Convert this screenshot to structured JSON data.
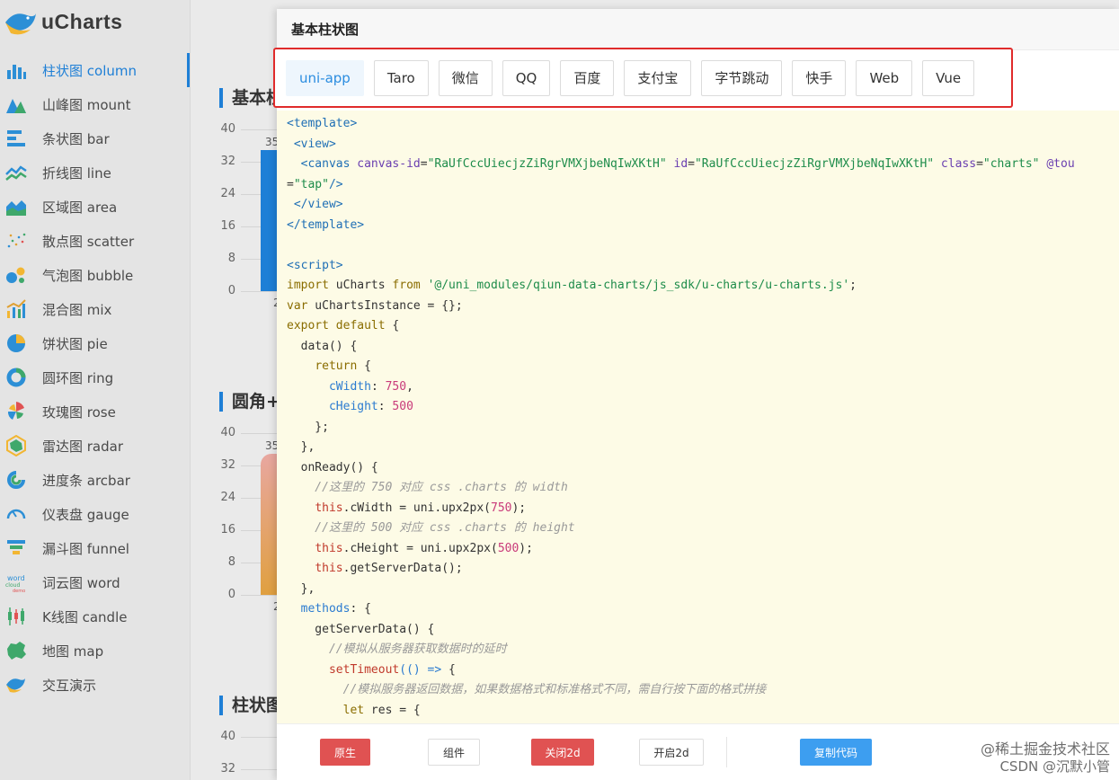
{
  "app": {
    "logo_text": "uCharts"
  },
  "sidebar": {
    "items": [
      {
        "label": "柱状图  column",
        "icon": "column-chart-icon",
        "active": true
      },
      {
        "label": "山峰图  mount",
        "icon": "mountain-chart-icon"
      },
      {
        "label": "条状图  bar",
        "icon": "bar-chart-icon"
      },
      {
        "label": "折线图  line",
        "icon": "line-chart-icon"
      },
      {
        "label": "区域图  area",
        "icon": "area-chart-icon"
      },
      {
        "label": "散点图  scatter",
        "icon": "scatter-chart-icon"
      },
      {
        "label": "气泡图  bubble",
        "icon": "bubble-chart-icon"
      },
      {
        "label": "混合图  mix",
        "icon": "mix-chart-icon"
      },
      {
        "label": "饼状图  pie",
        "icon": "pie-chart-icon"
      },
      {
        "label": "圆环图  ring",
        "icon": "ring-chart-icon"
      },
      {
        "label": "玫瑰图  rose",
        "icon": "rose-chart-icon"
      },
      {
        "label": "雷达图  radar",
        "icon": "radar-chart-icon"
      },
      {
        "label": "进度条  arcbar",
        "icon": "arcbar-chart-icon"
      },
      {
        "label": "仪表盘  gauge",
        "icon": "gauge-chart-icon"
      },
      {
        "label": "漏斗图  funnel",
        "icon": "funnel-chart-icon"
      },
      {
        "label": "词云图  word",
        "icon": "wordcloud-chart-icon"
      },
      {
        "label": "K线图  candle",
        "icon": "candle-chart-icon"
      },
      {
        "label": "地图  map",
        "icon": "map-chart-icon"
      },
      {
        "label": "交互演示",
        "icon": "logo-bird-icon"
      }
    ]
  },
  "background": {
    "sections": [
      {
        "title": "基本柱",
        "yticks": [
          "40",
          "32",
          "24",
          "16",
          "8",
          "0"
        ],
        "bar_value_label": "35",
        "bar_value": 35,
        "ymax": 40,
        "x_label": "2"
      },
      {
        "title": "圆角+",
        "yticks": [
          "40",
          "32",
          "24",
          "16",
          "8",
          "0"
        ],
        "bar_value_label": "35",
        "bar_value": 35,
        "ymax": 40,
        "x_label": "2"
      },
      {
        "title": "柱状图",
        "yticks": [
          "40",
          "32"
        ]
      }
    ]
  },
  "modal": {
    "title": "基本柱状图",
    "tabs": [
      {
        "label": "uni-app",
        "active": true
      },
      {
        "label": "Taro"
      },
      {
        "label": "微信"
      },
      {
        "label": "QQ"
      },
      {
        "label": "百度"
      },
      {
        "label": "支付宝"
      },
      {
        "label": "字节跳动"
      },
      {
        "label": "快手"
      },
      {
        "label": "Web"
      },
      {
        "label": "Vue"
      }
    ],
    "code_lines": [
      [
        [
          "t",
          "<template>"
        ]
      ],
      [
        [
          "p",
          " "
        ],
        [
          "t",
          "<view>"
        ]
      ],
      [
        [
          "p",
          "  "
        ],
        [
          "t",
          "<canvas "
        ],
        [
          "a",
          "canvas-id"
        ],
        [
          "p",
          "="
        ],
        [
          "s",
          "\"RaUfCccUiecjzZiRgrVMXjbeNqIwXKtH\""
        ],
        [
          "p",
          " "
        ],
        [
          "a",
          "id"
        ],
        [
          "p",
          "="
        ],
        [
          "s",
          "\"RaUfCccUiecjzZiRgrVMXjbeNqIwXKtH\""
        ],
        [
          "p",
          " "
        ],
        [
          "a",
          "class"
        ],
        [
          "p",
          "="
        ],
        [
          "s",
          "\"charts\""
        ],
        [
          "p",
          " "
        ],
        [
          "a",
          "@tou"
        ]
      ],
      [
        [
          "p",
          "="
        ],
        [
          "s",
          "\"tap\""
        ],
        [
          "t",
          "/>"
        ]
      ],
      [
        [
          "p",
          " "
        ],
        [
          "t",
          "</view>"
        ]
      ],
      [
        [
          "t",
          "</template>"
        ]
      ],
      [
        [
          "p",
          ""
        ]
      ],
      [
        [
          "t",
          "<script>"
        ]
      ],
      [
        [
          "k",
          "import"
        ],
        [
          "p",
          " uCharts "
        ],
        [
          "k",
          "from"
        ],
        [
          "p",
          " "
        ],
        [
          "s",
          "'@/uni_modules/qiun-data-charts/js_sdk/u-charts/u-charts.js'"
        ],
        [
          "p",
          ";"
        ]
      ],
      [
        [
          "k",
          "var"
        ],
        [
          "p",
          " uChartsInstance = {};"
        ]
      ],
      [
        [
          "k",
          "export default"
        ],
        [
          "p",
          " {"
        ]
      ],
      [
        [
          "p",
          "  data() {"
        ]
      ],
      [
        [
          "p",
          "    "
        ],
        [
          "k",
          "return"
        ],
        [
          "p",
          " {"
        ]
      ],
      [
        [
          "p",
          "      "
        ],
        [
          "r",
          "cWidth"
        ],
        [
          "p",
          ": "
        ],
        [
          "n",
          "750"
        ],
        [
          "p",
          ","
        ]
      ],
      [
        [
          "p",
          "      "
        ],
        [
          "r",
          "cHeight"
        ],
        [
          "p",
          ": "
        ],
        [
          "n",
          "500"
        ]
      ],
      [
        [
          "p",
          "    };"
        ]
      ],
      [
        [
          "p",
          "  },"
        ]
      ],
      [
        [
          "p",
          "  onReady() {"
        ]
      ],
      [
        [
          "c",
          "    //这里的 750 对应 css .charts 的 width"
        ]
      ],
      [
        [
          "p",
          "    "
        ],
        [
          "h",
          "this"
        ],
        [
          "p",
          ".cWidth = uni.upx2px("
        ],
        [
          "n",
          "750"
        ],
        [
          "p",
          ");"
        ]
      ],
      [
        [
          "c",
          "    //这里的 500 对应 css .charts 的 height"
        ]
      ],
      [
        [
          "p",
          "    "
        ],
        [
          "h",
          "this"
        ],
        [
          "p",
          ".cHeight = uni.upx2px("
        ],
        [
          "n",
          "500"
        ],
        [
          "p",
          ");"
        ]
      ],
      [
        [
          "p",
          "    "
        ],
        [
          "h",
          "this"
        ],
        [
          "p",
          ".getServerData();"
        ]
      ],
      [
        [
          "p",
          "  },"
        ]
      ],
      [
        [
          "p",
          "  "
        ],
        [
          "r",
          "methods"
        ],
        [
          "p",
          ": {"
        ]
      ],
      [
        [
          "p",
          "    getServerData() {"
        ]
      ],
      [
        [
          "c",
          "      //模拟从服务器获取数据时的延时"
        ]
      ],
      [
        [
          "p",
          "      "
        ],
        [
          "f",
          "setTimeout"
        ],
        [
          "r",
          "(() =>"
        ],
        [
          "p",
          " {"
        ]
      ],
      [
        [
          "c",
          "        //模拟服务器返回数据，如果数据格式和标准格式不同，需自行按下面的格式拼接"
        ]
      ],
      [
        [
          "p",
          "        "
        ],
        [
          "k",
          "let"
        ],
        [
          "p",
          " res = {"
        ]
      ]
    ],
    "footer": {
      "native_label": "原生",
      "component_label": "组件",
      "close2d_label": "关闭2d",
      "open2d_label": "开启2d",
      "copy_label": "复制代码"
    },
    "watermark_1": "@稀土掘金技术社区",
    "watermark_2": "CSDN @沉默小管"
  }
}
